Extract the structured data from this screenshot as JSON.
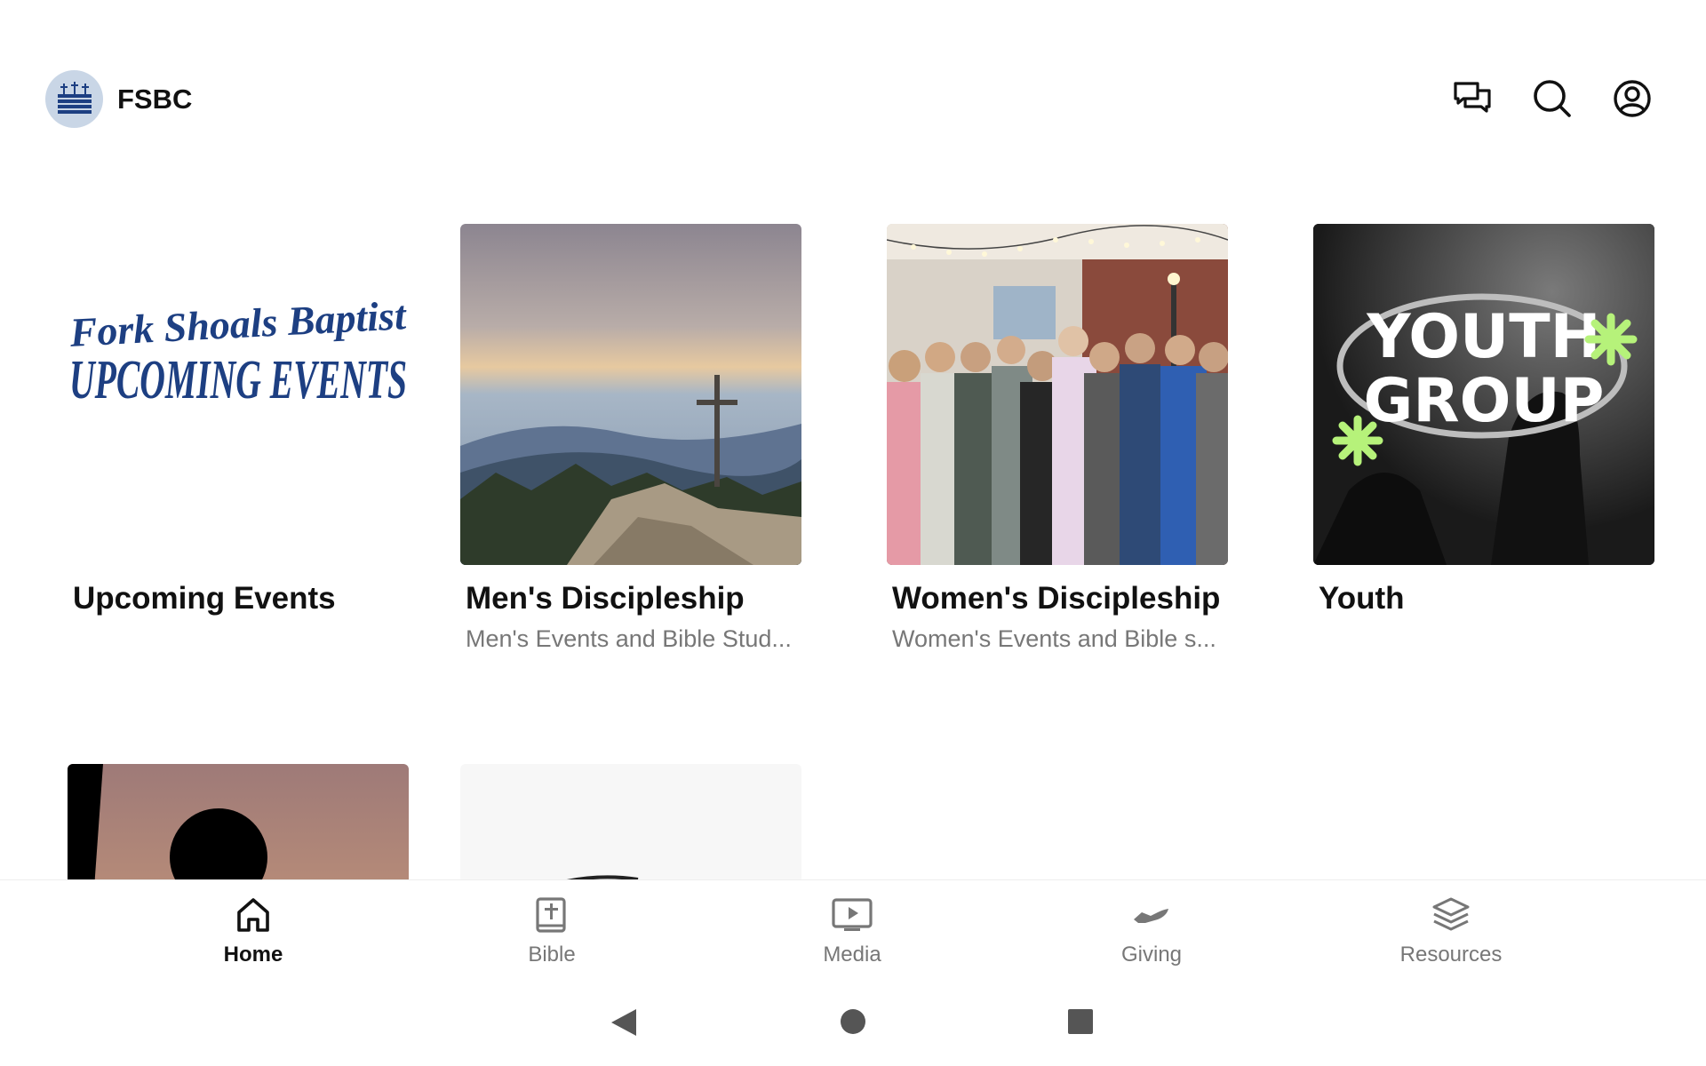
{
  "app": {
    "name": "FSBC"
  },
  "header": {
    "icons": [
      "chat-icon",
      "search-icon",
      "account-icon"
    ]
  },
  "cards": [
    {
      "title": "Upcoming Events",
      "subtitle": "",
      "image_text": {
        "line1": "Fork Shoals Baptist",
        "line2": "UPCOMING EVENTS"
      }
    },
    {
      "title": "Men's Discipleship",
      "subtitle": "Men's Events and Bible Stud..."
    },
    {
      "title": "Women's Discipleship",
      "subtitle": "Women's Events and Bible s..."
    },
    {
      "title": "Youth",
      "subtitle": "",
      "image_text": {
        "line1": "YOUTH",
        "line2": "GROUP"
      }
    }
  ],
  "bottom_nav": {
    "items": [
      {
        "label": "Home",
        "icon": "home-icon",
        "active": true
      },
      {
        "label": "Bible",
        "icon": "bible-icon",
        "active": false
      },
      {
        "label": "Media",
        "icon": "media-icon",
        "active": false
      },
      {
        "label": "Giving",
        "icon": "giving-icon",
        "active": false
      },
      {
        "label": "Resources",
        "icon": "resources-icon",
        "active": false
      }
    ]
  },
  "colors": {
    "brand_blue": "#1d3f82",
    "youth_green": "#b6f27a",
    "active_nav": "#111111",
    "inactive_nav": "#777777"
  }
}
